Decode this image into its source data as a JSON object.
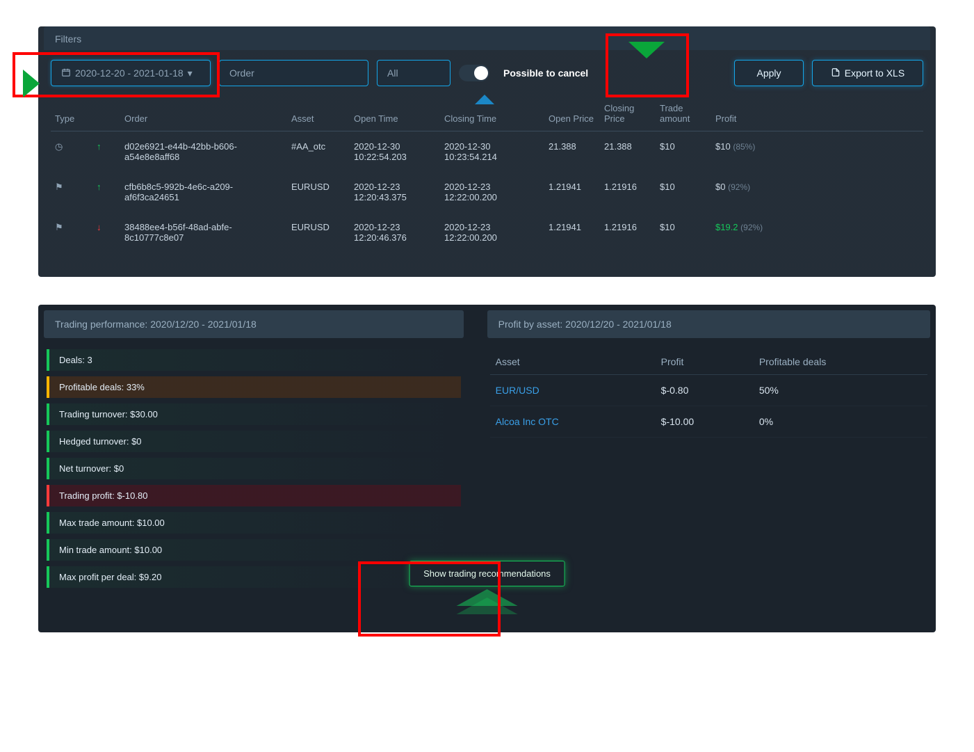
{
  "filters": {
    "title": "Filters",
    "date_range": "2020-12-20 - 2021-01-18",
    "order_placeholder": "Order",
    "all_label": "All",
    "possible_to_cancel": "Possible to cancel",
    "apply": "Apply",
    "export": "Export to XLS"
  },
  "columns": {
    "type": "Type",
    "order": "Order",
    "asset": "Asset",
    "open_time": "Open Time",
    "closing_time": "Closing Time",
    "open_price": "Open Price",
    "closing_price": "Closing Price",
    "trade_amount": "Trade amount",
    "profit": "Profit"
  },
  "rows": [
    {
      "type_icon": "◷",
      "dir": "↑",
      "dir_class": "up",
      "order": "d02e6921-e44b-42bb-b606-a54e8e8aff68",
      "asset": "#AA_otc",
      "open_time_d": "2020-12-30",
      "open_time_t": "10:22:54.203",
      "close_time_d": "2020-12-30",
      "close_time_t": "10:23:54.214",
      "open_price": "21.388",
      "closing_price": "21.388",
      "amount": "$10",
      "profit": "$10",
      "profit_class": "",
      "pct": "(85%)"
    },
    {
      "type_icon": "⚑",
      "dir": "↑",
      "dir_class": "up",
      "order": "cfb6b8c5-992b-4e6c-a209-af6f3ca24651",
      "asset": "EURUSD",
      "open_time_d": "2020-12-23",
      "open_time_t": "12:20:43.375",
      "close_time_d": "2020-12-23",
      "close_time_t": "12:22:00.200",
      "open_price": "1.21941",
      "closing_price": "1.21916",
      "amount": "$10",
      "profit": "$0",
      "profit_class": "",
      "pct": "(92%)"
    },
    {
      "type_icon": "⚑",
      "dir": "↓",
      "dir_class": "down",
      "order": "38488ee4-b56f-48ad-abfe-8c10777c8e07",
      "asset": "EURUSD",
      "open_time_d": "2020-12-23",
      "open_time_t": "12:20:46.376",
      "close_time_d": "2020-12-23",
      "close_time_t": "12:22:00.200",
      "open_price": "1.21941",
      "closing_price": "1.21916",
      "amount": "$10",
      "profit": "$19.2",
      "profit_class": "profit-green",
      "pct": "(92%)"
    }
  ],
  "performance": {
    "title": "Trading performance: 2020/12/20 - 2021/01/18",
    "stats": [
      {
        "cls": "green",
        "text": "Deals: 3"
      },
      {
        "cls": "orange",
        "text": "Profitable deals: 33%"
      },
      {
        "cls": "green",
        "text": "Trading turnover: $30.00"
      },
      {
        "cls": "green",
        "text": "Hedged turnover: $0"
      },
      {
        "cls": "green",
        "text": "Net turnover: $0"
      },
      {
        "cls": "red",
        "text": "Trading profit: $-10.80"
      },
      {
        "cls": "green",
        "text": "Max trade amount: $10.00"
      },
      {
        "cls": "green",
        "text": "Min trade amount: $10.00"
      },
      {
        "cls": "green",
        "text": "Max profit per deal: $9.20"
      }
    ],
    "reco_button": "Show trading recommendations"
  },
  "profit_by_asset": {
    "title": "Profit by asset: 2020/12/20 - 2021/01/18",
    "columns": {
      "asset": "Asset",
      "profit": "Profit",
      "deals": "Profitable deals"
    },
    "rows": [
      {
        "asset": "EUR/USD",
        "profit": "$-0.80",
        "deals": "50%"
      },
      {
        "asset": "Alcoa Inc OTC",
        "profit": "$-10.00",
        "deals": "0%"
      }
    ]
  }
}
